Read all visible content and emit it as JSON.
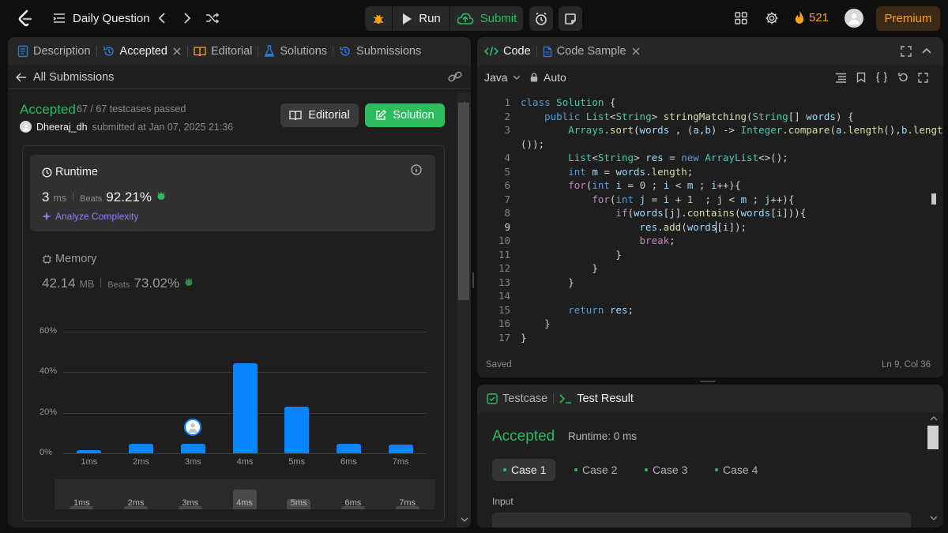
{
  "topnav": {
    "title": "Daily Question",
    "run_label": "Run",
    "submit_label": "Submit",
    "streak_count": "521",
    "premium_label": "Premium"
  },
  "left": {
    "tabs": [
      "Description",
      "Accepted",
      "Editorial",
      "Solutions",
      "Submissions"
    ],
    "back_label": "All Submissions",
    "status": "Accepted",
    "testcases": "67 / 67 testcases passed",
    "user": "Dheeraj_dh",
    "submitted_at": "submitted at Jan 07, 2025 21:36",
    "editorial_btn": "Editorial",
    "solution_btn": "Solution",
    "runtime": {
      "title": "Runtime",
      "value": "3",
      "unit": "ms",
      "beats_label": "Beats",
      "beats": "92.21%",
      "analyze": "Analyze Complexity"
    },
    "memory": {
      "title": "Memory",
      "value": "42.14",
      "unit": "MB",
      "beats_label": "Beats",
      "beats": "73.02%"
    }
  },
  "chart_data": {
    "type": "bar",
    "categories": [
      "1ms",
      "2ms",
      "3ms",
      "4ms",
      "5ms",
      "6ms",
      "7ms"
    ],
    "values": [
      1.5,
      4.8,
      4.6,
      44.5,
      22.8,
      4.6,
      4.2
    ],
    "y_ticks": [
      "60%",
      "40%",
      "20%",
      "0%"
    ],
    "ylim": [
      0,
      60
    ],
    "highlight_category": "3ms",
    "grid": true,
    "navigator_labels": [
      "1ms",
      "2ms",
      "3ms",
      "4ms",
      "5ms",
      "6ms",
      "7ms"
    ]
  },
  "right": {
    "tabs": [
      "Code",
      "Code Sample"
    ],
    "language": "Java",
    "mode": "Auto",
    "saved": "Saved",
    "cursor": "Ln 9, Col 36",
    "code_lines": [
      "class Solution {",
      "    public List<String> stringMatching(String[] words) {",
      "        Arrays.sort(words , (a,b) -> Integer.compare(a.length(),b.length",
      "());",
      "        List<String> res = new ArrayList<>();",
      "        int m = words.length;",
      "        for(int i = 0 ; i < m ; i++){",
      "            for(int j = i + 1  ; j < m ; j++){",
      "                if(words[j].contains(words[i])){",
      "                    res.add(words[i]);",
      "                    break;",
      "                }",
      "            }",
      "        }",
      "",
      "        return res;",
      "    }",
      "}"
    ],
    "line_numbers": [
      "1",
      "2",
      "3",
      "",
      "4",
      "5",
      "6",
      "7",
      "8",
      "9",
      "10",
      "11",
      "12",
      "13",
      "14",
      "15",
      "16",
      "17"
    ]
  },
  "bottom": {
    "tabs": [
      "Testcase",
      "Test Result"
    ],
    "status": "Accepted",
    "runtime": "Runtime: 0 ms",
    "cases": [
      "Case 1",
      "Case 2",
      "Case 3",
      "Case 4"
    ],
    "input_label": "Input"
  }
}
